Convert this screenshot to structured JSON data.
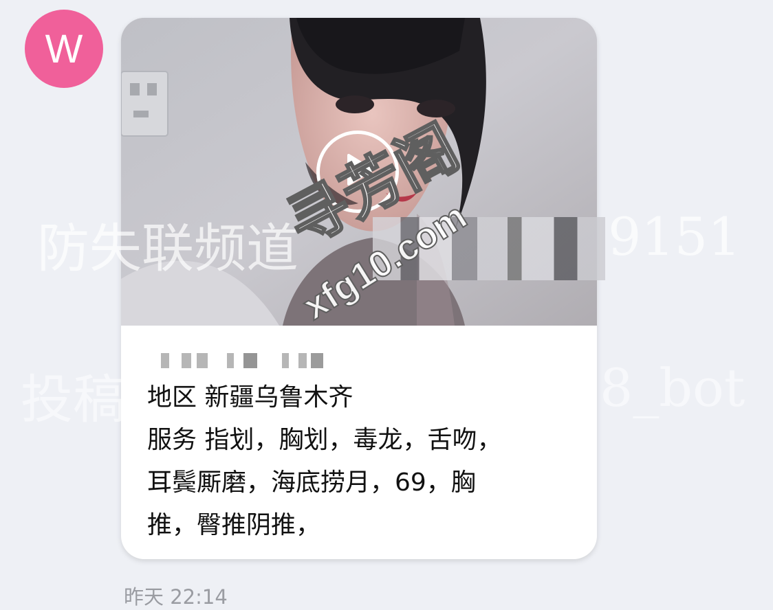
{
  "message": {
    "avatar_letter": "W",
    "video": {
      "play_icon": "play-icon"
    },
    "caption": {
      "region": "地区 新疆乌鲁木齐",
      "service_lines": [
        "服务 指划，胸划，毒龙，舌吻，",
        "耳鬓厮磨，海底捞月，69，胸",
        "推，臀推阴推，"
      ]
    },
    "timestamp": "昨天 22:14"
  },
  "watermarks": {
    "line1_prefix": "防失联频道",
    "line1_suffix": "9151",
    "line2_prefix": "投稿",
    "line2_suffix": "8_bot",
    "site_name": "寻芳阁",
    "site_url": "xfg10.com"
  },
  "colors": {
    "avatar": "#f0609a",
    "background": "#eef0f5",
    "bubble": "#ffffff",
    "timestamp": "#9a9ca2"
  }
}
